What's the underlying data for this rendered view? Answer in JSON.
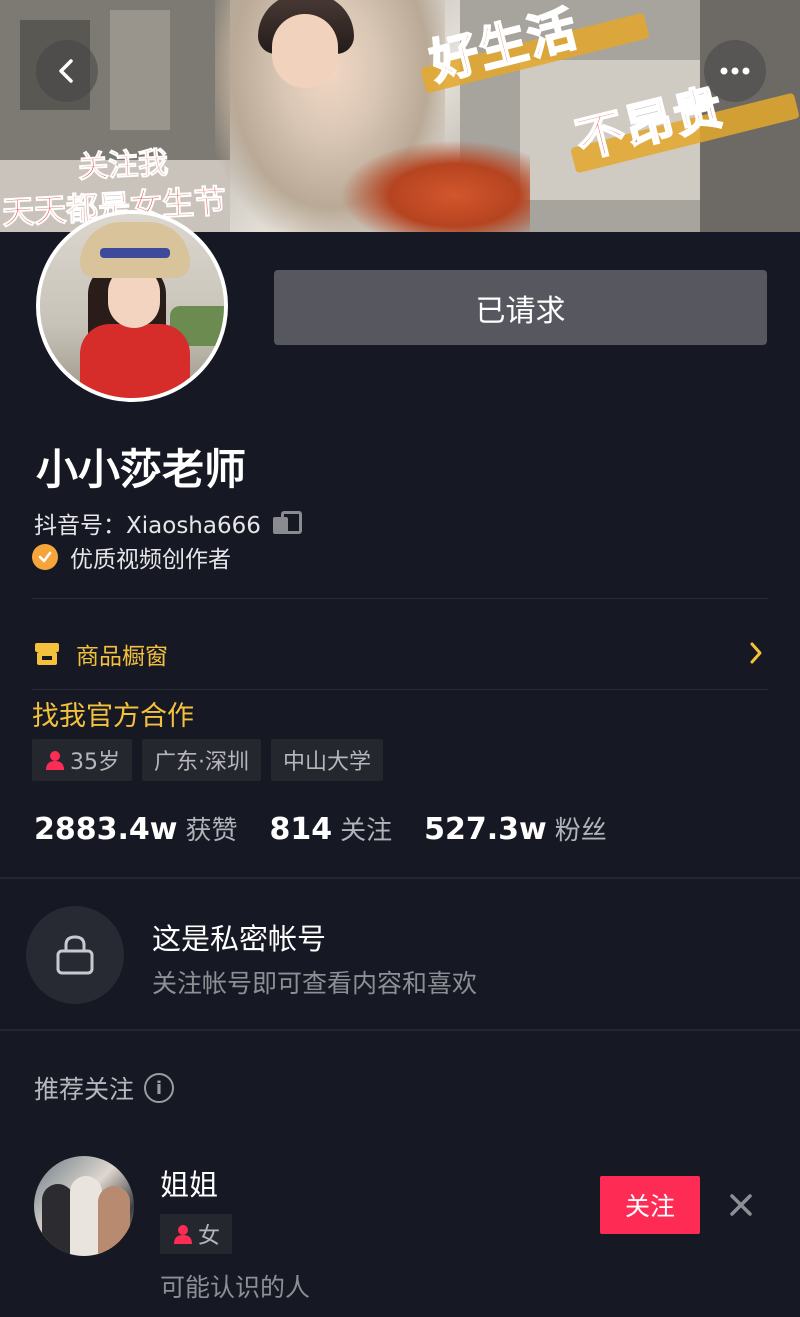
{
  "header": {
    "banner_texts": [
      "好生活",
      "不昂贵",
      "关注我",
      "天天都是女生节"
    ],
    "back_icon": "chevron-left-icon",
    "more_icon": "more-dots-icon"
  },
  "profile": {
    "request_button": "已请求",
    "name": "小小莎老师",
    "douyin_id": "抖音号：Xiaosha666",
    "verified_label": "优质视频创作者"
  },
  "shop": {
    "label": "商品橱窗"
  },
  "cooperation": "找我官方合作",
  "tags": {
    "age": "35岁",
    "location": "广东·深圳",
    "school": "中山大学"
  },
  "stats": {
    "likes_num": "2883.4w",
    "likes_label": "获赞",
    "following_num": "814",
    "following_label": "关注",
    "fans_num": "527.3w",
    "fans_label": "粉丝"
  },
  "private": {
    "title": "这是私密帐号",
    "subtitle": "关注帐号即可查看内容和喜欢"
  },
  "recommend": {
    "title": "推荐关注",
    "items": [
      {
        "name": "姐姐",
        "gender": "女",
        "hint": "可能认识的人",
        "follow_label": "关注"
      }
    ]
  },
  "colors": {
    "background": "#161823",
    "accent_yellow": "#f4c13d",
    "follow_red": "#fe2c55",
    "verified_orange": "#f6a53b"
  }
}
